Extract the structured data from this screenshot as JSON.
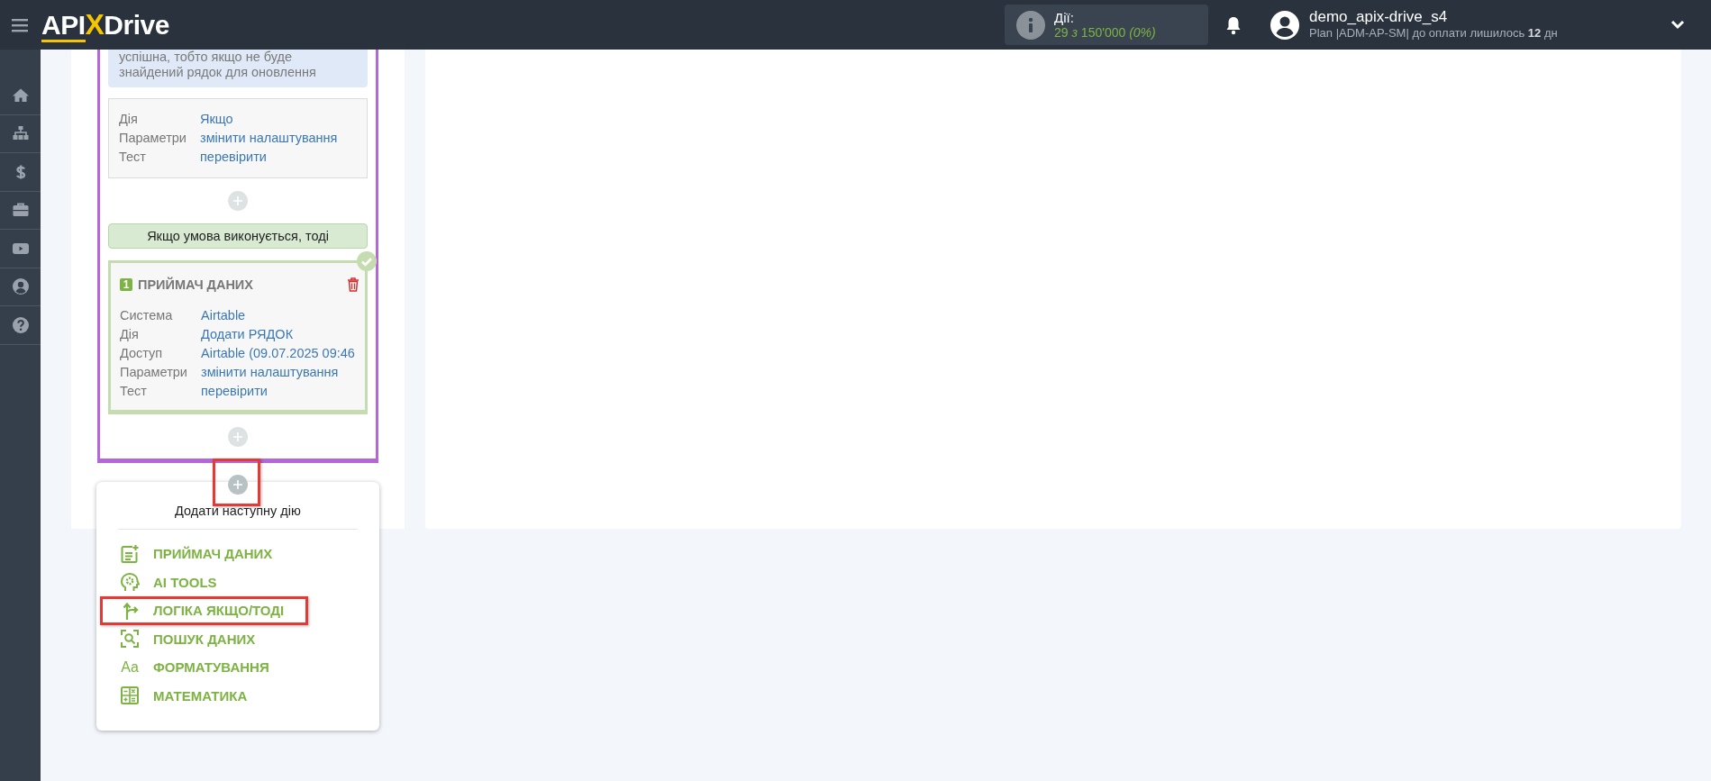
{
  "header": {
    "logo": [
      {
        "text": "API",
        "kind": "plain"
      },
      {
        "text": "X",
        "kind": "accent"
      },
      {
        "text": "Drive",
        "kind": "plain"
      }
    ],
    "actions": {
      "label": "Дії:",
      "usage": "29 *з* 150'000 *(0%)*"
    },
    "user": {
      "name": "demo_apix-drive_s4",
      "plan": "Plan |ADM-AP-SM| до оплати лишилось **12** дн"
    }
  },
  "sidebar": {
    "items": [
      {
        "kind": "home"
      },
      {
        "kind": "sitemap"
      },
      {
        "kind": "dollar"
      },
      {
        "kind": "briefcase"
      },
      {
        "kind": "video"
      },
      {
        "kind": "user"
      },
      {
        "kind": "help"
      }
    ]
  },
  "logic_block": {
    "info_text": "успішна, тобто якщо не буде знайдений рядок для оновлення",
    "condition_card": {
      "rows": [
        {
          "label": "Дія",
          "value": "Якщо"
        },
        {
          "label": "Параметри",
          "value": "змінити налаштування"
        },
        {
          "label": "Тест",
          "value": "перевірити"
        }
      ]
    },
    "then_banner": "Якщо умова виконується, тоді",
    "receiver_card": {
      "number": "1",
      "title": "ПРИЙМАЧ ДАНИХ",
      "done": true,
      "rows": [
        {
          "label": "Система",
          "value": "Airtable"
        },
        {
          "label": "Дія",
          "value": "Додати РЯДОК"
        },
        {
          "label": "Доступ",
          "value": "Airtable (09.07.2025 09:46"
        },
        {
          "label": "Параметри",
          "value": "змінити налаштування"
        },
        {
          "label": "Тест",
          "value": "перевірити"
        }
      ]
    }
  },
  "add_button": {
    "highlighted": true
  },
  "add_menu": {
    "title": "Додати наступну дію",
    "items": [
      {
        "label": "ПРИЙМАЧ ДАНИХ",
        "highlighted": false
      },
      {
        "label": "AI TOOLS",
        "highlighted": false
      },
      {
        "label": "ЛОГІКА ЯКЩО/ТОДІ",
        "highlighted": true
      },
      {
        "label": "ПОШУК ДАНИХ",
        "highlighted": false
      },
      {
        "label": "ФОРМАТУВАННЯ",
        "glyph": "Aa",
        "highlighted": false
      },
      {
        "label": "МАТЕМАТИКА",
        "highlighted": false
      }
    ]
  }
}
